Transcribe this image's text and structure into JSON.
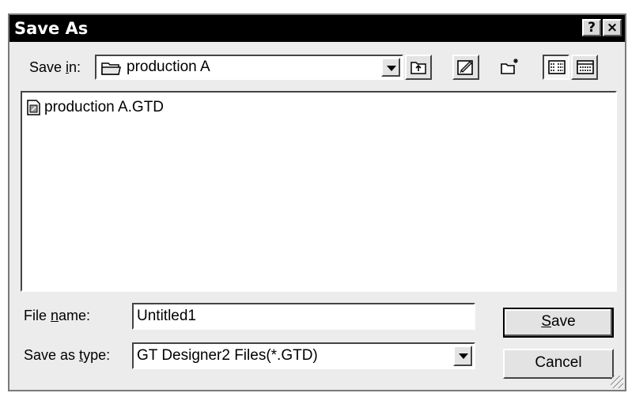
{
  "dialog": {
    "title": "Save As",
    "help_symbol": "?",
    "close_symbol": "×"
  },
  "save_in": {
    "label_prefix": "Save ",
    "label_key": "i",
    "label_suffix": "n:",
    "value": "production A",
    "icon": "folder-icon"
  },
  "toolbar": {
    "up_icon": "up-one-level-icon",
    "desktop_icon": "desktop-icon",
    "new_folder_icon": "new-folder-icon",
    "list_icon": "list-view-icon",
    "details_icon": "details-view-icon"
  },
  "files": [
    {
      "name": "production A.GTD",
      "icon": "gtd-file-icon"
    }
  ],
  "file_name": {
    "label_prefix": "File ",
    "label_key": "n",
    "label_suffix": "ame:",
    "value": "Untitled1"
  },
  "save_as_type": {
    "label_prefix": "Save as ",
    "label_key": "t",
    "label_suffix": "ype:",
    "value": "GT Designer2 Files(*.GTD)"
  },
  "buttons": {
    "save_key": "S",
    "save_rest": "ave",
    "cancel": "Cancel"
  }
}
